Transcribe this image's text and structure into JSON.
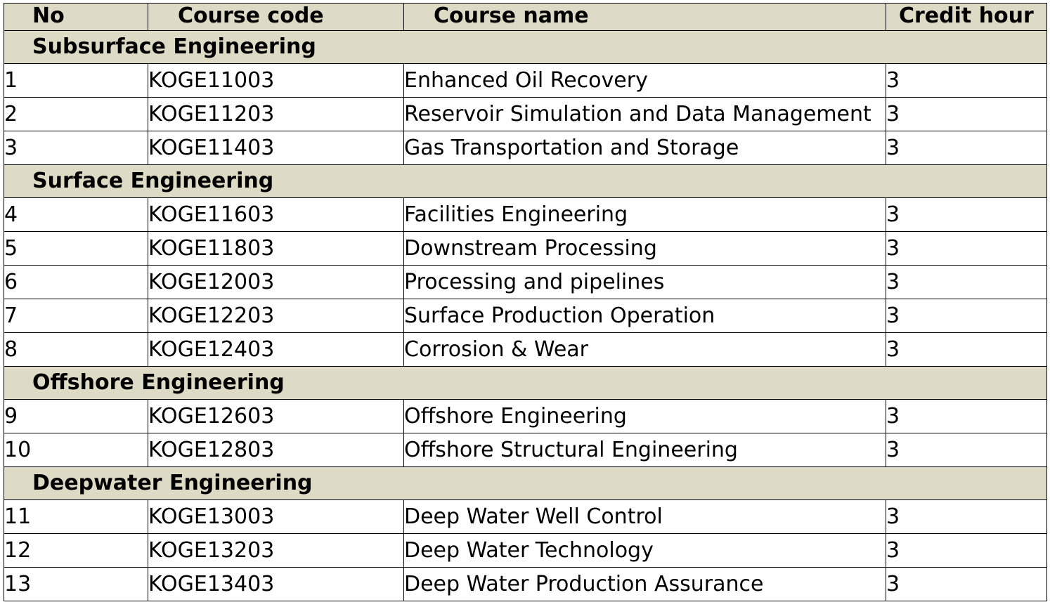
{
  "headers": {
    "no": "No",
    "code": "Course code",
    "name": "Course name",
    "credit": "Credit hour"
  },
  "groups": [
    {
      "title": "Subsurface Engineering",
      "rows": [
        {
          "no": "1",
          "code": "KOGE11003",
          "name": "Enhanced Oil Recovery",
          "credit": "3"
        },
        {
          "no": "2",
          "code": "KOGE11203",
          "name": "Reservoir Simulation and Data Management",
          "credit": "3"
        },
        {
          "no": "3",
          "code": "KOGE11403",
          "name": "Gas Transportation and Storage",
          "credit": "3"
        }
      ]
    },
    {
      "title": "Surface Engineering",
      "rows": [
        {
          "no": "4",
          "code": "KOGE11603",
          "name": "Facilities Engineering",
          "credit": "3"
        },
        {
          "no": "5",
          "code": "KOGE11803",
          "name": "Downstream Processing",
          "credit": "3"
        },
        {
          "no": "6",
          "code": "KOGE12003",
          "name": "Processing and pipelines",
          "credit": "3"
        },
        {
          "no": "7",
          "code": "KOGE12203",
          "name": "Surface Production Operation",
          "credit": "3"
        },
        {
          "no": "8",
          "code": "KOGE12403",
          "name": "Corrosion & Wear",
          "credit": "3"
        }
      ]
    },
    {
      "title": "Offshore Engineering",
      "rows": [
        {
          "no": "9",
          "code": "KOGE12603",
          "name": "Offshore Engineering",
          "credit": "3"
        },
        {
          "no": "10",
          "code": "KOGE12803",
          "name": "Offshore Structural Engineering",
          "credit": "3"
        }
      ]
    },
    {
      "title": "Deepwater Engineering",
      "rows": [
        {
          "no": "11",
          "code": "KOGE13003",
          "name": "Deep Water Well Control",
          "credit": "3"
        },
        {
          "no": "12",
          "code": "KOGE13203",
          "name": "Deep Water Technology",
          "credit": "3"
        },
        {
          "no": "13",
          "code": "KOGE13403",
          "name": "Deep Water Production Assurance",
          "credit": "3"
        }
      ]
    }
  ]
}
